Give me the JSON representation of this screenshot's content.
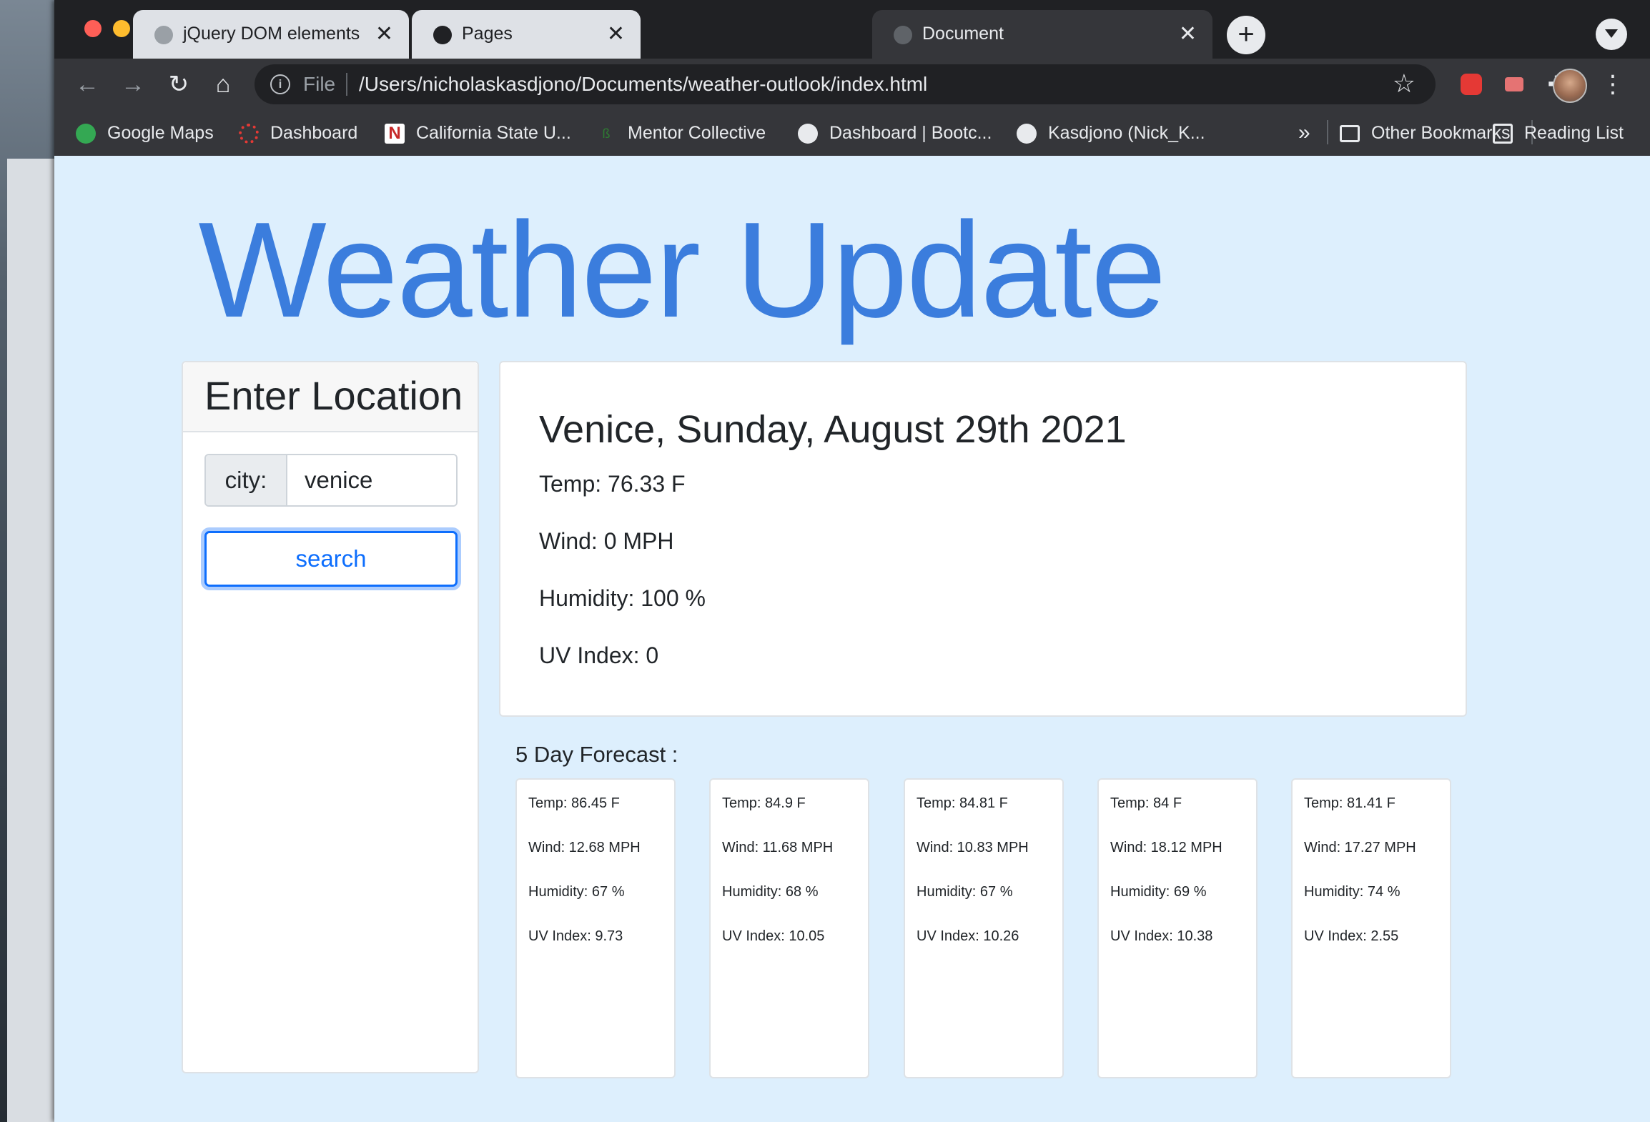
{
  "browser": {
    "tabs": [
      {
        "label": "jQuery DOM elements",
        "close": "✕"
      },
      {
        "label": "Pages",
        "close": "✕"
      },
      {
        "label": "Document",
        "close": "✕"
      }
    ],
    "new_tab_glyph": "+",
    "toolbar": {
      "back_glyph": "←",
      "forward_glyph": "→",
      "reload_glyph": "↻",
      "home_glyph": "⌂",
      "scheme_label": "File",
      "url": "/Users/nicholaskasdjono/Documents/weather-outlook/index.html",
      "star_glyph": "☆",
      "menu_glyph": "⋮",
      "puzzle_glyph": "✚",
      "reading_glyph": "≡"
    },
    "bookmarks": [
      {
        "label": "Google Maps",
        "icon": "google-maps-icon",
        "color": "#34a853"
      },
      {
        "label": "Dashboard",
        "icon": "dashboard-icon",
        "color": "#e53935"
      },
      {
        "label": "California State U...",
        "icon": "csun-icon",
        "color": "#c62828"
      },
      {
        "label": "Mentor Collective",
        "icon": "mentor-collective-icon",
        "color": "#1b5e20"
      },
      {
        "label": "Dashboard | Bootc...",
        "icon": "globe-icon",
        "color": "#e8eaed"
      },
      {
        "label": "Kasdjono (Nick_K...",
        "icon": "github-icon",
        "color": "#e8eaed"
      }
    ],
    "bookmarks_overflow": "»",
    "other_bookmarks": "Other Bookmarks",
    "reading_list": "Reading List"
  },
  "page": {
    "title": "Weather Update",
    "location": {
      "heading": "Enter Location",
      "prefix": "city:",
      "value": "venice",
      "button": "search"
    },
    "current": {
      "heading": "Venice, Sunday, August 29th 2021",
      "temp": "Temp: 76.33 F",
      "wind": "Wind: 0 MPH",
      "humidity": "Humidity: 100 %",
      "uv": "UV Index: 0"
    },
    "forecast_title": "5 Day Forecast :",
    "forecast": [
      {
        "temp": "Temp: 86.45 F",
        "wind": "Wind: 12.68 MPH",
        "humidity": "Humidity: 67 %",
        "uv": "UV Index: 9.73"
      },
      {
        "temp": "Temp: 84.9 F",
        "wind": "Wind: 11.68 MPH",
        "humidity": "Humidity: 68 %",
        "uv": "UV Index: 10.05"
      },
      {
        "temp": "Temp: 84.81 F",
        "wind": "Wind: 10.83 MPH",
        "humidity": "Humidity: 67 %",
        "uv": "UV Index: 10.26"
      },
      {
        "temp": "Temp: 84 F",
        "wind": "Wind: 18.12 MPH",
        "humidity": "Humidity: 69 %",
        "uv": "UV Index: 10.38"
      },
      {
        "temp": "Temp: 81.41 F",
        "wind": "Wind: 17.27 MPH",
        "humidity": "Humidity: 74 %",
        "uv": "UV Index: 2.55"
      }
    ]
  },
  "colors": {
    "title_blue": "#3b7ddd",
    "page_background": "#ddeffd",
    "button_blue": "#0d6efd"
  }
}
